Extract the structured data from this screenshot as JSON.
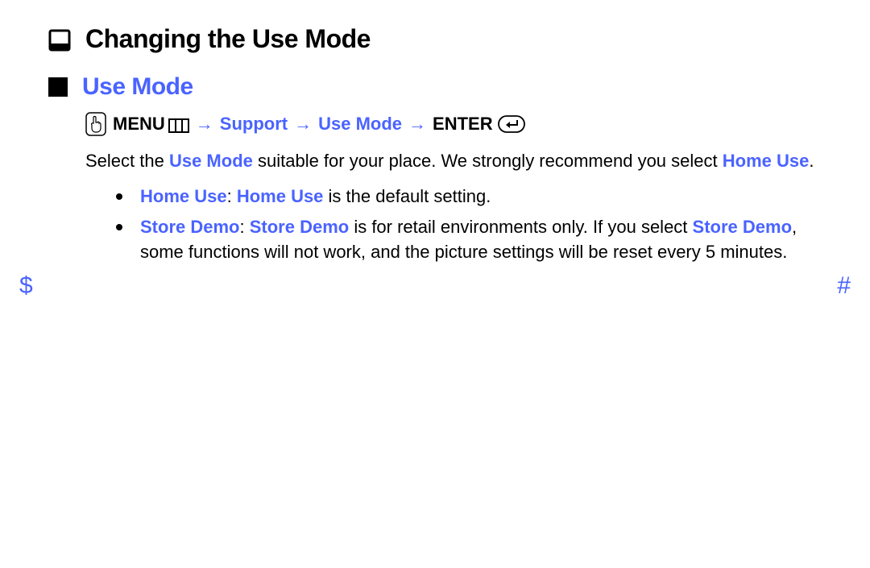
{
  "title": "Changing the Use Mode",
  "section": "Use Mode",
  "path": {
    "menu": "MENU",
    "support": "Support",
    "usemode": "Use Mode",
    "enter": "ENTER",
    "arrow": "→"
  },
  "body": {
    "p1a": "Select the ",
    "p1_hl1": "Use Mode",
    "p1b": " suitable for your place. We strongly recommend you select ",
    "p1_hl2": "Home Use",
    "p1c": "."
  },
  "bullets": {
    "b1": {
      "hl1": "Home Use",
      "sep": ": ",
      "hl2": "Home Use",
      "rest": " is the default setting."
    },
    "b2": {
      "hl1": "Store Demo",
      "sep": ": ",
      "hl2": "Store Demo",
      "mid": " is for retail environments only. If you select ",
      "hl3": "Store Demo",
      "rest": ", some functions will not work, and the picture settings will be reset every 5 minutes."
    }
  },
  "nav": {
    "left": "$",
    "right": "#"
  }
}
